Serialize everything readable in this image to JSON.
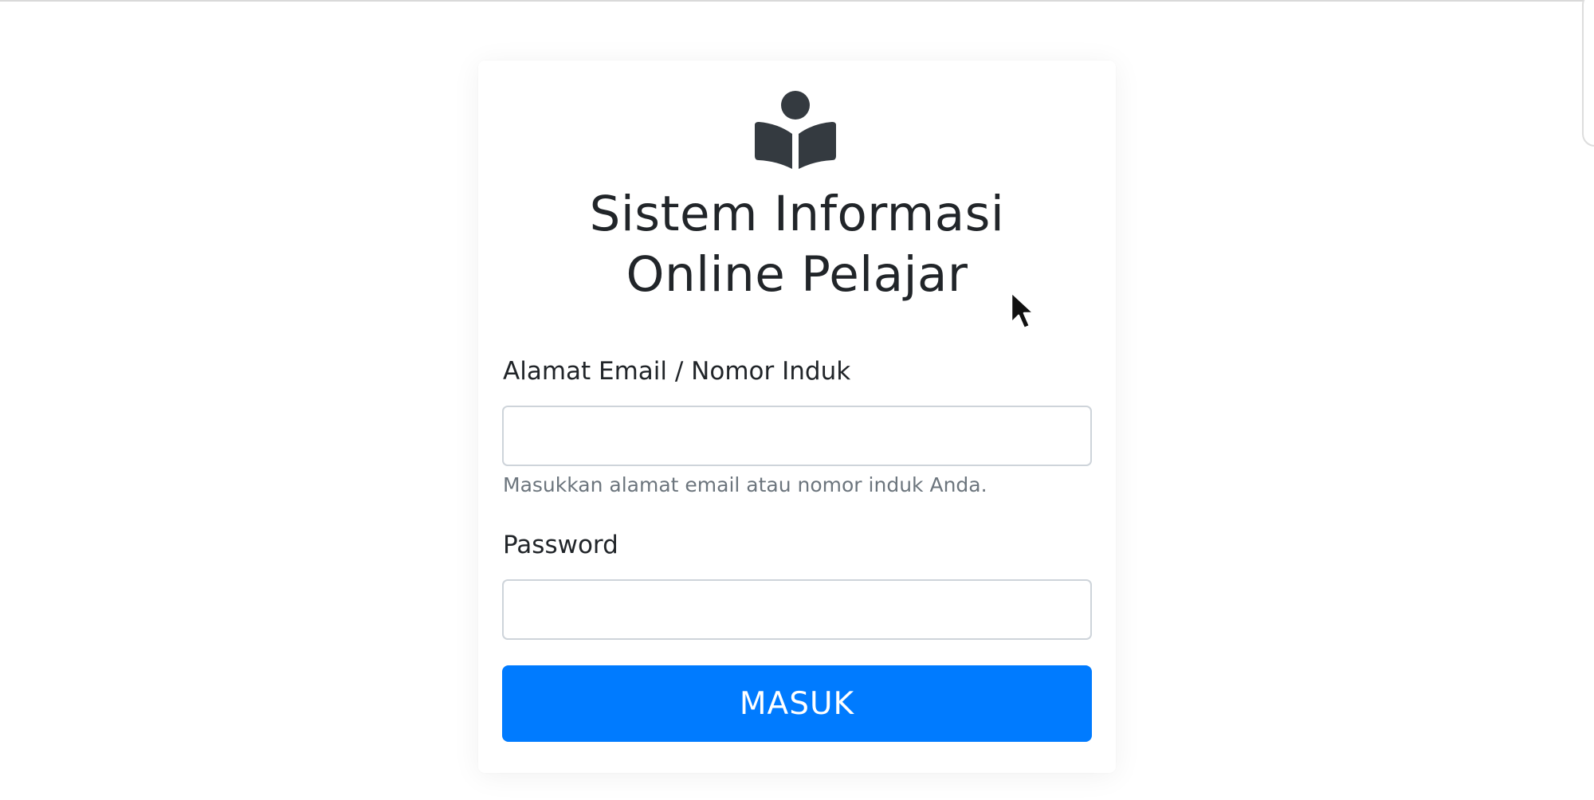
{
  "app": {
    "title_line1": "Sistem Informasi",
    "title_line2": "Online Pelajar",
    "logo_icon": "book-reader-icon"
  },
  "form": {
    "email": {
      "label": "Alamat Email / Nomor Induk",
      "value": "",
      "placeholder": "",
      "help": "Masukkan alamat email atau nomor induk Anda."
    },
    "password": {
      "label": "Password",
      "value": "",
      "placeholder": ""
    },
    "submit_label": "MASUK"
  },
  "colors": {
    "primary": "#007bff",
    "text": "#212529",
    "muted": "#6c757d",
    "input_border": "#ced4da",
    "logo": "#343a40"
  }
}
